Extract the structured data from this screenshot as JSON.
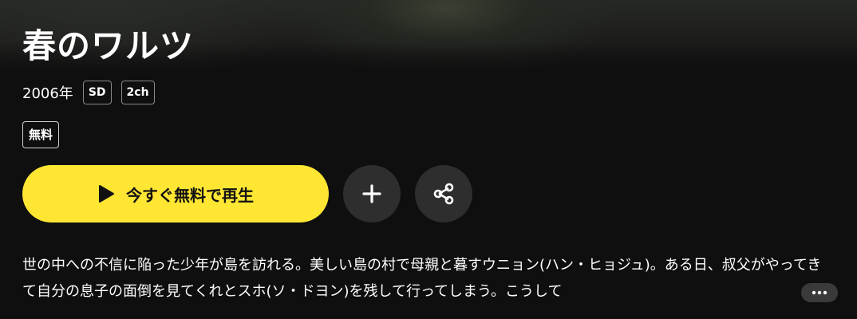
{
  "title": "春のワルツ",
  "meta": {
    "year": "2006年",
    "badges": [
      "SD",
      "2ch"
    ]
  },
  "price_badge": "無料",
  "actions": {
    "play_label": "今すぐ無料で再生",
    "play_icon": "play-icon",
    "add_icon": "plus-icon",
    "share_icon": "share-icon"
  },
  "description": "世の中への不信に陥った少年が島を訪れる。美しい島の村で母親と暮すウニョン(ハン・ヒョジュ)。ある日、叔父がやってきて自分の息子の面倒を見てくれとスホ(ソ・ドヨン)を残して行ってしまう。こうして",
  "more_icon": "more-dots-icon",
  "colors": {
    "accent": "#ffe633",
    "background": "#0f0f0f",
    "round_button": "#2e2e2e"
  }
}
